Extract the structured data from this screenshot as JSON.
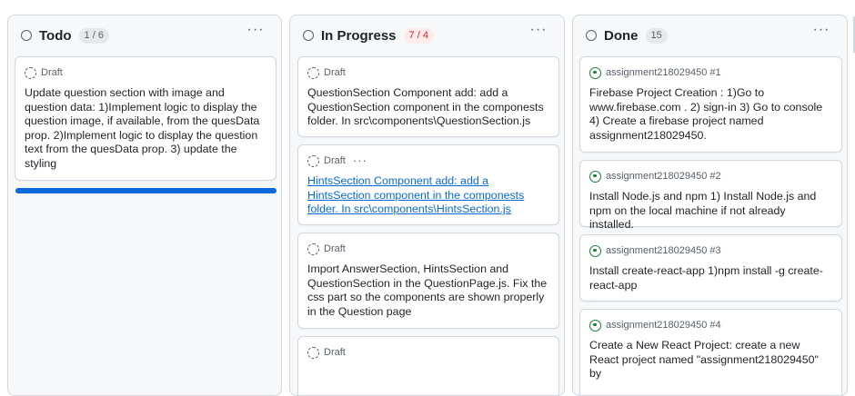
{
  "columns": [
    {
      "title": "Todo",
      "count": "1 / 6",
      "more": "···",
      "cards": [
        {
          "type": "draft",
          "meta": "Draft",
          "title": "Update question section with image and question data: 1)Implement logic to display the question image, if available, from the quesData prop. 2)Implement logic to display the question text from the quesData prop. 3) update the styling"
        }
      ]
    },
    {
      "title": "In Progress",
      "count": "7 / 4",
      "more": "···",
      "cards": [
        {
          "type": "draft",
          "meta": "Draft",
          "title": "QuestionSection Component add: add a QuestionSection component in the componests folder. In src\\components\\QuestionSection.js"
        },
        {
          "type": "draft",
          "meta": "Draft",
          "meta_more": "···",
          "title": "HintsSection Component add: add a HintsSection component in the componests folder. In src\\components\\HintsSection.js"
        },
        {
          "type": "draft",
          "meta": "Draft",
          "title": "Import AnswerSection, HintsSection and QuestionSection in the QuestionPage.js. Fix the css part so the components are shown properly in the Question page"
        },
        {
          "type": "draft",
          "meta": "Draft",
          "title": ""
        }
      ]
    },
    {
      "title": "Done",
      "count": "15",
      "more": "···",
      "cards": [
        {
          "type": "issue",
          "meta": "assignment218029450 #1",
          "title": "Firebase Project Creation : 1)Go to www.firebase.com . 2) sign-in 3) Go to console 4) Create a firebase project named assignment218029450."
        },
        {
          "type": "issue",
          "meta": "assignment218029450 #2",
          "title": "Install Node.js and npm 1) Install Node.js and npm on the local machine if not already installed."
        },
        {
          "type": "issue",
          "meta": "assignment218029450 #3",
          "title": "Install create-react-app 1)npm install -g create-react-app"
        },
        {
          "type": "issue",
          "meta": "assignment218029450 #4",
          "title": "Create a New React Project: create a new React project named \"assignment218029450\" by"
        }
      ]
    }
  ],
  "colors": {
    "column_bg": "#f6f8fa",
    "border": "#d0d7de",
    "accent_blue": "#0969da",
    "done_green": "#1a7f37",
    "over_limit_red": "#cf222e"
  },
  "icons": {
    "column_status": "circle-icon",
    "draft": "draft-dashed-circle-icon",
    "issue": "issue-closed-circle-icon",
    "more": "kebab-horizontal-icon"
  }
}
